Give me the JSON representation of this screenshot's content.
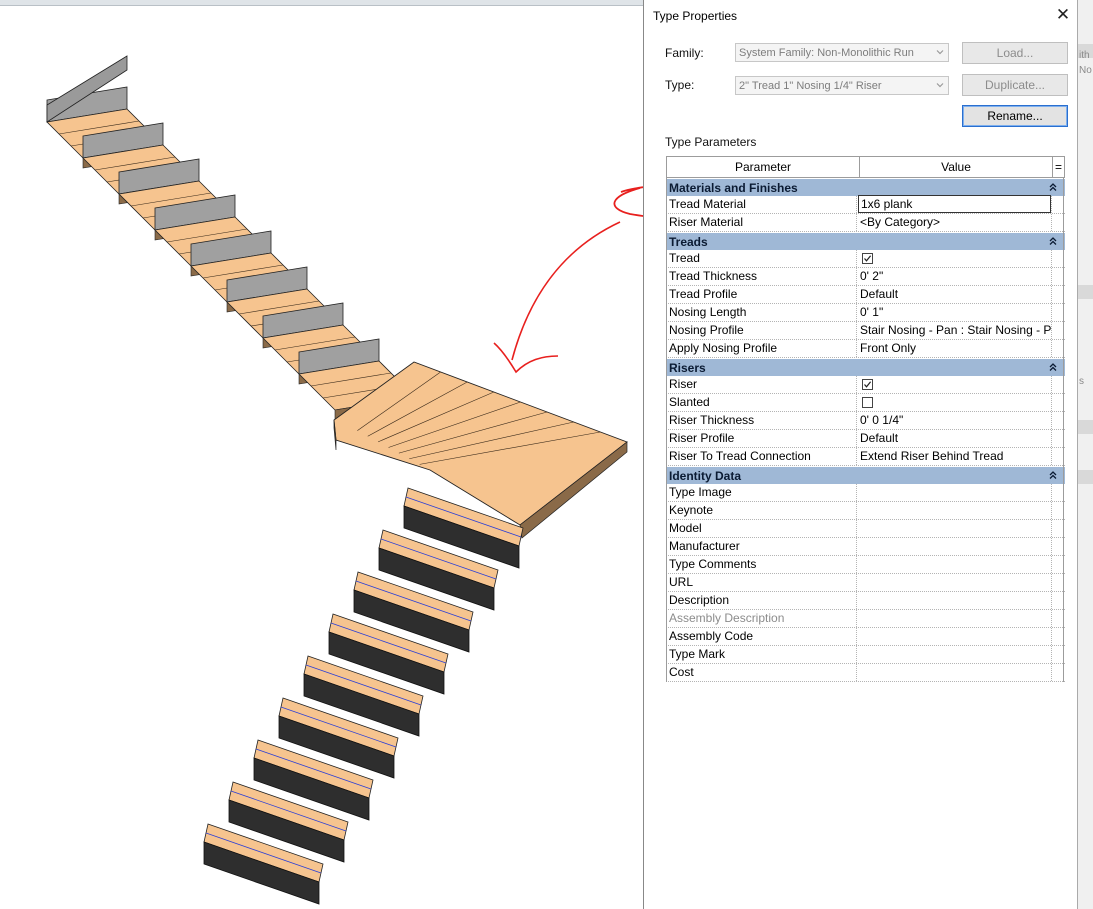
{
  "dialog": {
    "title": "Type Properties",
    "family_label": "Family:",
    "family_value": "System Family: Non-Monolithic Run",
    "type_label": "Type:",
    "type_value": "2\" Tread 1\" Nosing 1/4\" Riser",
    "load_button": "Load...",
    "duplicate_button": "Duplicate...",
    "rename_button": "Rename...",
    "type_parameters_label": "Type Parameters"
  },
  "grid": {
    "parameter_header": "Parameter",
    "value_header": "Value",
    "sort_header": "="
  },
  "groups": [
    {
      "id": "materials",
      "label": "Materials and Finishes",
      "rows": [
        {
          "param": "Tread Material",
          "value": "1x6 plank",
          "editing": true
        },
        {
          "param": "Riser Material",
          "value": "<By Category>"
        }
      ]
    },
    {
      "id": "treads",
      "label": "Treads",
      "rows": [
        {
          "param": "Tread",
          "checkbox": true,
          "checked": true
        },
        {
          "param": "Tread Thickness",
          "value": "0'  2\""
        },
        {
          "param": "Tread Profile",
          "value": "Default"
        },
        {
          "param": "Nosing Length",
          "value": "0'  1\""
        },
        {
          "param": "Nosing Profile",
          "value": "Stair Nosing - Pan : Stair Nosing - P"
        },
        {
          "param": "Apply Nosing Profile",
          "value": "Front Only"
        }
      ]
    },
    {
      "id": "risers",
      "label": "Risers",
      "rows": [
        {
          "param": "Riser",
          "checkbox": true,
          "checked": true
        },
        {
          "param": "Slanted",
          "checkbox": true,
          "checked": false
        },
        {
          "param": "Riser Thickness",
          "value": "0'  0 1/4\""
        },
        {
          "param": "Riser Profile",
          "value": "Default"
        },
        {
          "param": "Riser To Tread Connection",
          "value": "Extend Riser Behind Tread"
        }
      ]
    },
    {
      "id": "identity",
      "label": "Identity Data",
      "rows": [
        {
          "param": "Type Image",
          "value": ""
        },
        {
          "param": "Keynote",
          "value": ""
        },
        {
          "param": "Model",
          "value": ""
        },
        {
          "param": "Manufacturer",
          "value": ""
        },
        {
          "param": "Type Comments",
          "value": ""
        },
        {
          "param": "URL",
          "value": ""
        },
        {
          "param": "Description",
          "value": ""
        },
        {
          "param": "Assembly Description",
          "value": "",
          "muted": true
        },
        {
          "param": "Assembly Code",
          "value": ""
        },
        {
          "param": "Type Mark",
          "value": ""
        },
        {
          "param": "Cost",
          "value": ""
        }
      ]
    }
  ],
  "background_fragments": [
    "ith",
    "No",
    "s"
  ],
  "colors": {
    "group_header": "#9fb8d6",
    "tread_wood": "#f6c48f",
    "riser_gray": "#a0a0a0",
    "riser_dark": "#2e2e2e",
    "markup_red": "#e8201e",
    "focus_blue": "#2a6fcf"
  },
  "icons": {
    "close": "close-icon",
    "dropdown": "chevron-down-icon",
    "collapse": "double-chevron-up-icon",
    "check": "check-icon"
  }
}
